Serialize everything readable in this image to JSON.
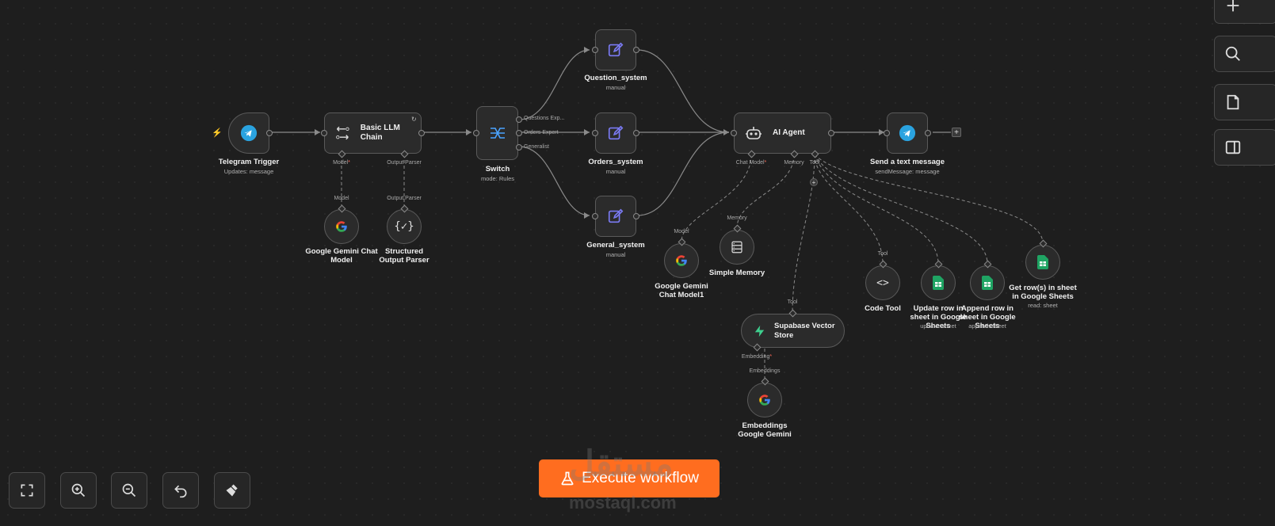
{
  "nodes": {
    "telegram_trigger": {
      "title": "Telegram Trigger",
      "subtitle": "Updates: message",
      "icon": "telegram-icon"
    },
    "basic_llm_chain": {
      "title": "Basic LLM Chain",
      "icon": "llm-chain-icon"
    },
    "switch": {
      "title": "Switch",
      "subtitle": "mode: Rules",
      "icon": "switch-icon",
      "outputs": [
        "Questions Exp...",
        "Orders Expert",
        "Generalist"
      ]
    },
    "question_system": {
      "title": "Question_system",
      "subtitle": "manual",
      "icon": "edit-icon"
    },
    "orders_system": {
      "title": "Orders_system",
      "subtitle": "manual",
      "icon": "edit-icon"
    },
    "general_system": {
      "title": "General_system",
      "subtitle": "manual",
      "icon": "edit-icon"
    },
    "ai_agent": {
      "title": "AI Agent",
      "icon": "robot-icon"
    },
    "send_text": {
      "title": "Send a text message",
      "subtitle": "sendMessage: message",
      "icon": "telegram-icon"
    },
    "gemini_chat": {
      "title": "Google Gemini Chat Model",
      "icon": "google-icon"
    },
    "structured_parser": {
      "title": "Structured Output Parser",
      "icon": "braces-icon"
    },
    "gemini_chat1": {
      "title": "Google Gemini Chat Model1",
      "icon": "google-icon"
    },
    "simple_memory": {
      "title": "Simple Memory",
      "icon": "database-icon"
    },
    "supabase": {
      "title": "Supabase Vector Store",
      "icon": "supabase-icon"
    },
    "embeddings": {
      "title": "Embeddings Google Gemini",
      "icon": "google-icon"
    },
    "code_tool": {
      "title": "Code Tool",
      "icon": "code-icon"
    },
    "update_row": {
      "title": "Update row in sheet in Google Sheets",
      "subtitle": "update: sheet",
      "icon": "sheets-icon"
    },
    "append_row": {
      "title": "Append row in sheet in Google Sheets",
      "subtitle": "append: sheet",
      "icon": "sheets-icon"
    },
    "get_rows": {
      "title": "Get row(s) in sheet in Google Sheets",
      "subtitle": "read: sheet",
      "icon": "sheets-icon"
    }
  },
  "port_labels": {
    "model": "Model",
    "output_parser": "Output Parser",
    "chat_model": "Chat Model",
    "memory": "Memory",
    "tool": "Tool",
    "embedding": "Embedding",
    "embeddings": "Embeddings",
    "required_mark": "*"
  },
  "execute_button": {
    "label": "Execute workflow",
    "icon": "flask-icon",
    "color": "#ff6d1f"
  },
  "watermark": {
    "arabic": "مستقل",
    "latin": "mostaql.com"
  },
  "colors": {
    "canvas": "#1e1e1e",
    "node": "#2b2b2b",
    "accent": "#ff6d1f",
    "edit_icon": "#7b7bf5",
    "switch_icon": "#4aa3ff",
    "sheets": "#1fa463",
    "supabase": "#3ecf8e",
    "telegram": "#2aa3e0"
  }
}
